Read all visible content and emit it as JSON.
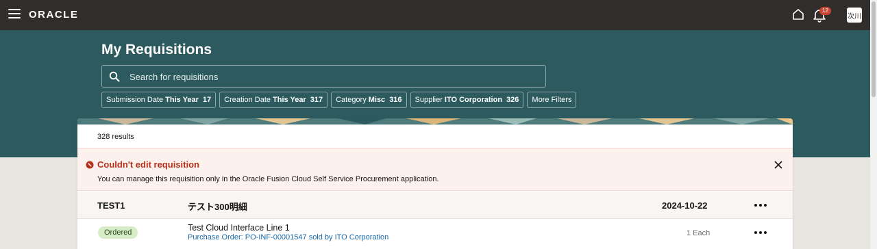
{
  "header": {
    "logo_text": "ORACLE",
    "notification_count": "12",
    "user_initials": "次川"
  },
  "page": {
    "title": "My Requisitions"
  },
  "search": {
    "placeholder": "Search for requisitions"
  },
  "filters": [
    {
      "label": "Submission Date",
      "value": "This Year",
      "count": "17"
    },
    {
      "label": "Creation Date",
      "value": "This Year",
      "count": "317"
    },
    {
      "label": "Category",
      "value": "Misc",
      "count": "316"
    },
    {
      "label": "Supplier",
      "value": "ITO Corporation",
      "count": "326"
    },
    {
      "label": "More Filters"
    }
  ],
  "results": {
    "count_text": "328 results"
  },
  "error": {
    "title": "Couldn't edit requisition",
    "message": "You can manage this requisition only in the Oracle Fusion Cloud Self Service Procurement application."
  },
  "requisition": {
    "id": "TEST1",
    "description": "テスト300明細",
    "date": "2024-10-22",
    "line": {
      "status": "Ordered",
      "title": "Test Cloud Interface Line 1",
      "link": "Purchase Order: PO-INF-00001547 sold by ITO Corporation",
      "quantity": "1 Each"
    }
  },
  "colors": {
    "topbar": "#312d2a",
    "band": "#2c5a5e",
    "error_red": "#b3311b",
    "link_blue": "#1767a6",
    "status_green": "#d7ebc7"
  }
}
